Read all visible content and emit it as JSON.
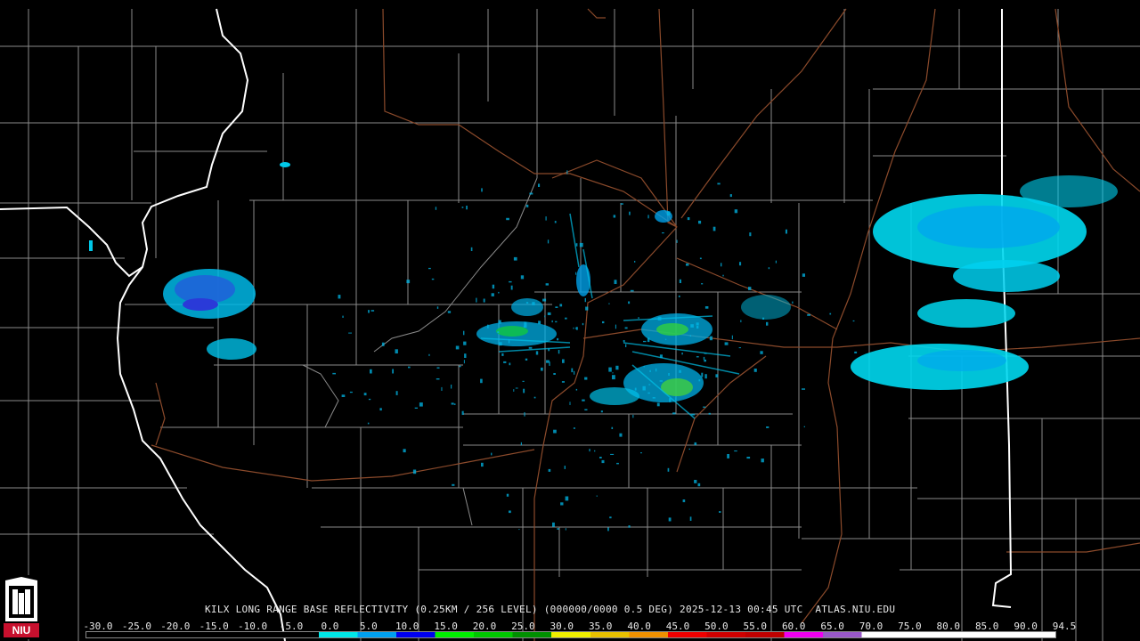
{
  "caption": "KILX LONG RANGE BASE REFLECTIVITY (0.25KM / 256 LEVEL) (000000/0000 0.5 DEG) 2025-12-13 00:45 UTC  ATLAS.NIU.EDU",
  "logo": {
    "text": "NIU",
    "color": "#c8102e"
  },
  "legend": {
    "ticks": [
      "-30.0",
      "-25.0",
      "-20.0",
      "-15.0",
      "-10.0",
      "-5.0",
      "0.0",
      "5.0",
      "10.0",
      "15.0",
      "20.0",
      "25.0",
      "30.0",
      "35.0",
      "40.0",
      "45.0",
      "50.0",
      "55.0",
      "60.0",
      "65.0",
      "70.0",
      "75.0",
      "80.0",
      "85.0",
      "90.0",
      "94.5"
    ],
    "colors": [
      "#000000",
      "#000000",
      "#000000",
      "#000000",
      "#000000",
      "#000000",
      "#00e8e8",
      "#00a0f0",
      "#0000f0",
      "#00f000",
      "#00c800",
      "#009000",
      "#f0f000",
      "#e8c000",
      "#f09000",
      "#f00000",
      "#d00000",
      "#c00000",
      "#f000f0",
      "#9858c8",
      "#ffffff",
      "#ffffff",
      "#ffffff",
      "#ffffff",
      "#ffffff"
    ]
  },
  "map_colors": {
    "background": "#000000",
    "county_lines": "#8a8a8a",
    "state_lines": "#ffffff",
    "highways": "#8b4a2b"
  }
}
